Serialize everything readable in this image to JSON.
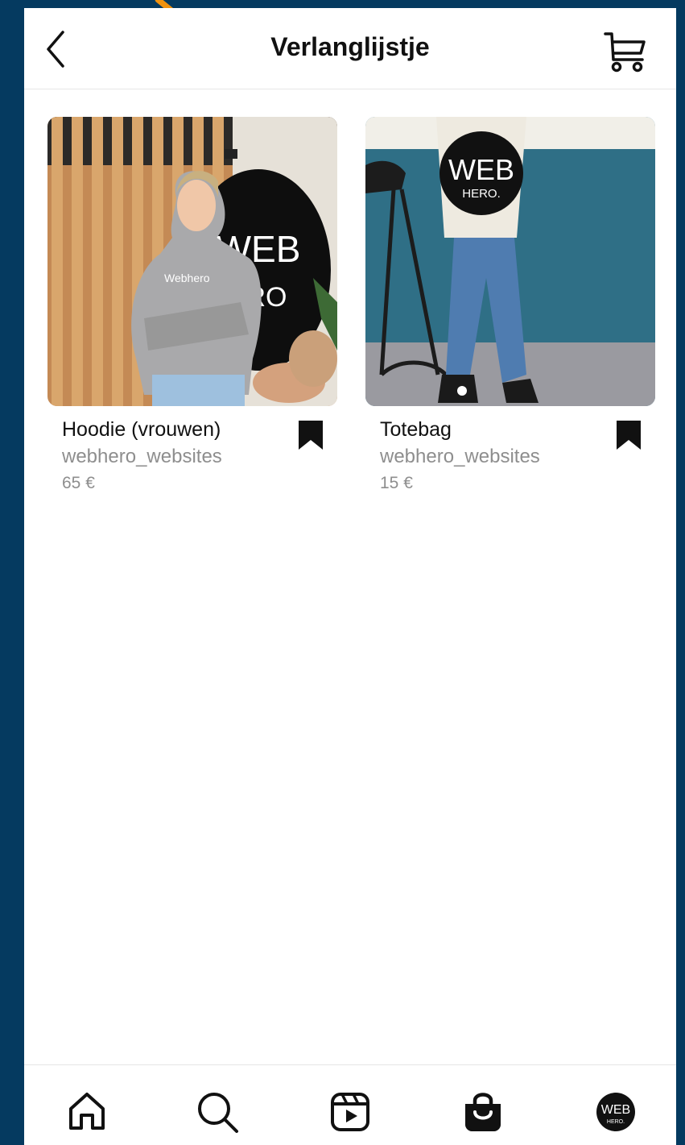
{
  "header": {
    "title": "Verlanglijstje",
    "back_icon": "chevron-left-icon",
    "cart_icon": "cart-icon"
  },
  "products": [
    {
      "name": "Hoodie (vrouwen)",
      "seller": "webhero_websites",
      "price": "65 €",
      "image": "woman in grey hoodie in office with WEB HERO logo wall",
      "saved": true
    },
    {
      "name": "Totebag",
      "seller": "webhero_websites",
      "price": "15 €",
      "image": "person holding cream tote bag with WEB HERO. logo",
      "saved": true
    }
  ],
  "tabbar": {
    "items": [
      "home-icon",
      "search-icon",
      "reels-icon",
      "shop-icon",
      "profile-avatar"
    ],
    "active": "shop-icon",
    "avatar_text_top": "WEB",
    "avatar_text_bottom": "HERO."
  },
  "colors": {
    "background": "#053a60",
    "annotation_arrow": "#f0920f",
    "notification_dot": "#ed4956",
    "secondary_text": "#8e8e8e"
  }
}
